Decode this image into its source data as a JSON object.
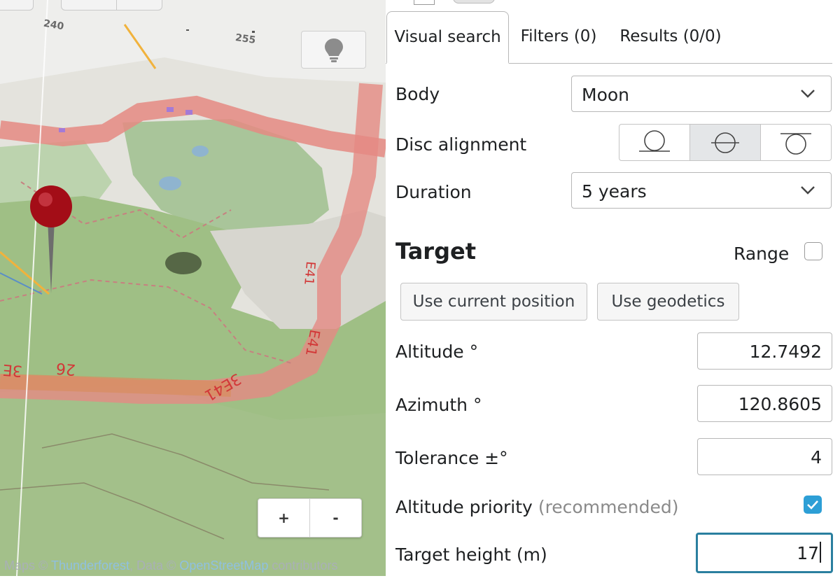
{
  "map": {
    "hint_button": {
      "icon": "lightbulb-icon"
    },
    "zoom": {
      "in_label": "+",
      "out_label": "-"
    },
    "labels": {
      "compass_240": "240",
      "compass_255": "255",
      "road_a": "26",
      "road_b": "3E",
      "road_c": "3E41",
      "road_d": "E41",
      "road_e": "E41"
    },
    "attribution": {
      "prefix": "Maps © ",
      "thunderforest": "Thunderforest",
      "data": ", Data © ",
      "osm": "OpenStreetMap",
      "suffix": " contributors"
    }
  },
  "panel": {
    "tabs": [
      {
        "label": "Visual search",
        "active": true
      },
      {
        "label": "Filters (0)",
        "active": false
      },
      {
        "label": "Results (0/0)",
        "active": false
      }
    ],
    "body": {
      "label": "Body",
      "value": "Moon"
    },
    "disc_alignment": {
      "label": "Disc alignment",
      "options": [
        "bottom-edge",
        "center",
        "top-edge"
      ],
      "selected": "center"
    },
    "duration": {
      "label": "Duration",
      "value": "5 years"
    },
    "target": {
      "heading": "Target",
      "range_label": "Range",
      "range_checked": false,
      "use_current_position": "Use current position",
      "use_geodetics": "Use geodetics"
    },
    "altitude": {
      "label": "Altitude °",
      "value": "12.7492"
    },
    "azimuth": {
      "label": "Azimuth °",
      "value": "120.8605"
    },
    "tolerance": {
      "label": "Tolerance ±°",
      "value": "4"
    },
    "altitude_priority": {
      "label": "Altitude priority",
      "note": "(recommended)",
      "checked": true
    },
    "target_height": {
      "label": "Target height (m)",
      "value": "17"
    }
  },
  "colors": {
    "accent": "#2d9fd6",
    "focus": "#2a7f9f",
    "pin": "#b0101a"
  }
}
